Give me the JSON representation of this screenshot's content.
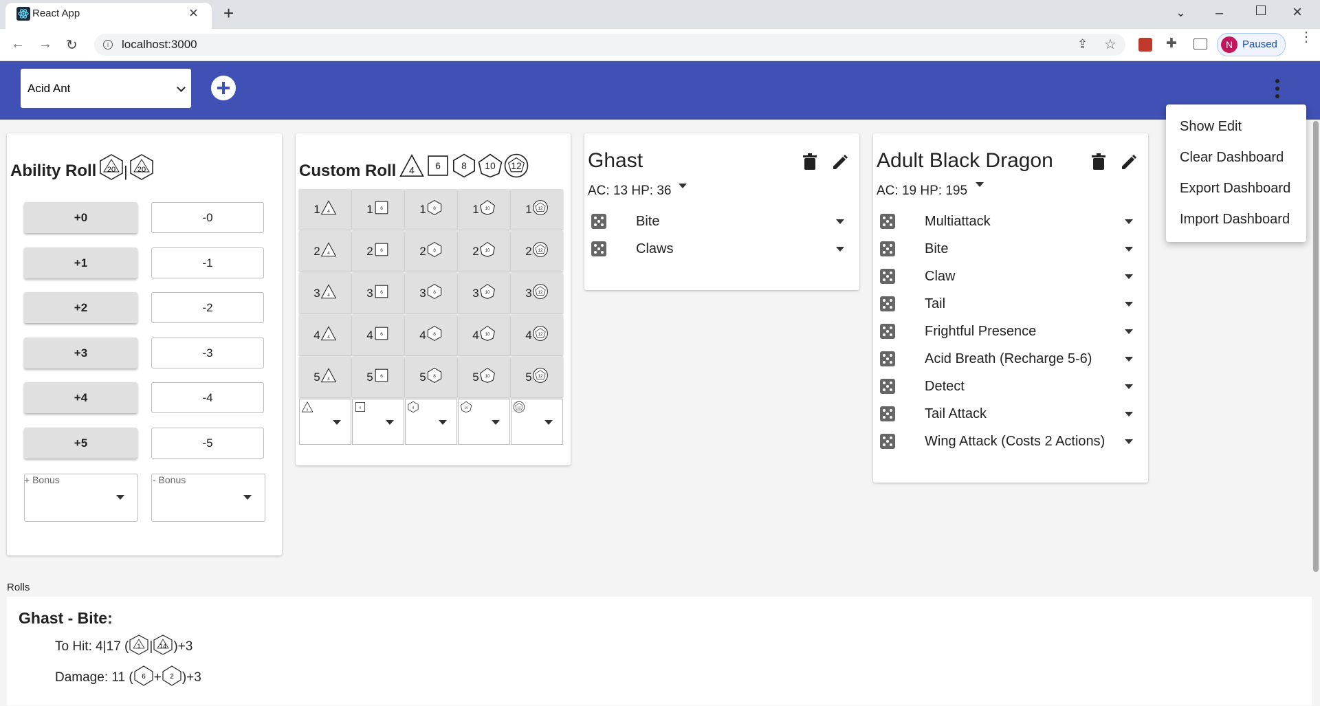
{
  "browser": {
    "tab_title": "React App",
    "url": "localhost:3000",
    "profile_initial": "N",
    "profile_status": "Paused"
  },
  "app": {
    "selected_monster": "Acid Ant",
    "add_icon": "plus-circle-icon",
    "menu_icon": "more-vert-icon"
  },
  "menu": {
    "items": [
      "Show Edit",
      "Clear Dashboard",
      "Export Dashboard",
      "Import Dashboard"
    ]
  },
  "ability_roll": {
    "title": "Ability Roll",
    "icon_die": "20",
    "plus": [
      "+0",
      "+1",
      "+2",
      "+3",
      "+4",
      "+5"
    ],
    "minus": [
      "-0",
      "-1",
      "-2",
      "-3",
      "-4",
      "-5"
    ],
    "plus_bonus_label": "+ Bonus",
    "minus_bonus_label": "- Bonus"
  },
  "custom_roll": {
    "title": "Custom Roll",
    "dice": [
      "4",
      "6",
      "8",
      "10",
      "12"
    ],
    "counts": [
      "1",
      "2",
      "3",
      "4",
      "5"
    ]
  },
  "monsters": [
    {
      "name": "Ghast",
      "stats": "AC: 13 HP: 36",
      "actions": [
        "Bite",
        "Claws"
      ]
    },
    {
      "name": "Adult Black Dragon",
      "stats": "AC: 19 HP: 195",
      "actions": [
        "Multiattack",
        "Bite",
        "Claw",
        "Tail",
        "Frightful Presence",
        "Acid Breath (Recharge 5-6)",
        "Detect",
        "Tail Attack",
        "Wing Attack (Costs 2 Actions)"
      ]
    }
  ],
  "rolls": {
    "label": "Rolls",
    "title": "Ghast - Bite:",
    "to_hit_text": "To Hit: 4|17 (",
    "to_hit_dice": [
      "1",
      "14"
    ],
    "to_hit_suffix": ")+3",
    "damage_text": "Damage: 11 (",
    "damage_dice": [
      "6",
      "2"
    ],
    "damage_suffix": ")+3"
  },
  "colors": {
    "appbar": "#3f51b5",
    "avatar": "#c2185b"
  }
}
